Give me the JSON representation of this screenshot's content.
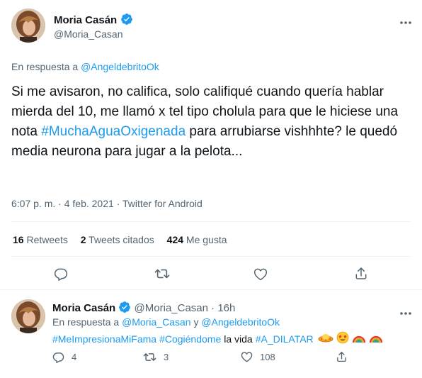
{
  "main_tweet": {
    "author_name": "Moria Casán",
    "author_handle": "@Moria_Casan",
    "reply_prefix": "En respuesta a",
    "reply_to": "@AngeldebritoOk",
    "text_before_hashtag": "Si me avisaron, no califica, solo califiqué cuando quería hablar mierda del 10, me llamó x tel tipo cholula para que le hiciese una nota ",
    "hashtag": "#MuchaAguaOxigenada",
    "text_after_hashtag": " para arrubiarse vishhhte? le quedó media neurona para jugar a la pelota...",
    "time": "6:07 p. m.",
    "date": "4 feb. 2021",
    "separator": "·",
    "source": "Twitter for Android",
    "stats": {
      "retweets_count": "16",
      "retweets_label": "Retweets",
      "quotes_count": "2",
      "quotes_label": "Tweets citados",
      "likes_count": "424",
      "likes_label": "Me gusta"
    }
  },
  "reply_tweet": {
    "author_name": "Moria Casán",
    "author_handle": "@Moria_Casan",
    "separator": "·",
    "age": "16h",
    "reply_prefix": "En respuesta a",
    "reply_to_1": "@Moria_Casan",
    "reply_and": "y",
    "reply_to_2": "@AngeldebritoOk",
    "hashtag_1": "#MeImpresionaMiFama",
    "hashtag_2": "#Cogiéndome",
    "text_mid": "la vida",
    "hashtag_3": "#A_DILATAR",
    "replies_count": "4",
    "retweets_count": "3",
    "likes_count": "108"
  },
  "icons": {
    "reply": "reply-icon",
    "retweet": "retweet-icon",
    "like": "heart-icon",
    "share": "share-icon",
    "verified": "verified-badge-icon",
    "more": "more-options-icon"
  },
  "colors": {
    "accent": "#1d9bf0",
    "muted": "#536471",
    "text": "#0f1419",
    "divider": "#eff3f4"
  }
}
